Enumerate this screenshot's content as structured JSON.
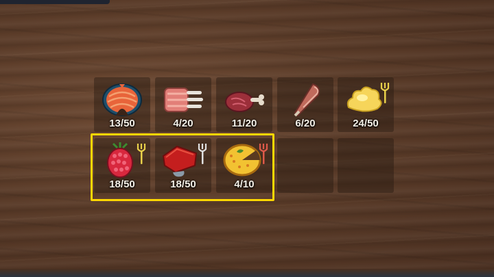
{
  "inventory": {
    "slots": [
      {
        "item": "serpent-meat",
        "count": "13/50",
        "edible_icon": false
      },
      {
        "item": "lox-ribs",
        "count": "4/20",
        "edible_icon": false
      },
      {
        "item": "raw-meat",
        "count": "11/20",
        "edible_icon": false
      },
      {
        "item": "deer-meat",
        "count": "6/20",
        "edible_icon": false
      },
      {
        "item": "honey-butter",
        "count": "24/50",
        "edible_icon": true,
        "fork_color": "#e8d04a"
      },
      {
        "item": "raspberries",
        "count": "18/50",
        "edible_icon": true,
        "fork_color": "#e8d04a"
      },
      {
        "item": "cooked-meat",
        "count": "18/50",
        "edible_icon": true,
        "fork_color": "#e0e0e0"
      },
      {
        "item": "pie",
        "count": "4/10",
        "edible_icon": true,
        "fork_color": "#e05a4a"
      },
      {
        "item": "empty",
        "count": ""
      },
      {
        "item": "empty",
        "count": ""
      }
    ]
  },
  "highlight": {
    "color": "#ffd700"
  }
}
